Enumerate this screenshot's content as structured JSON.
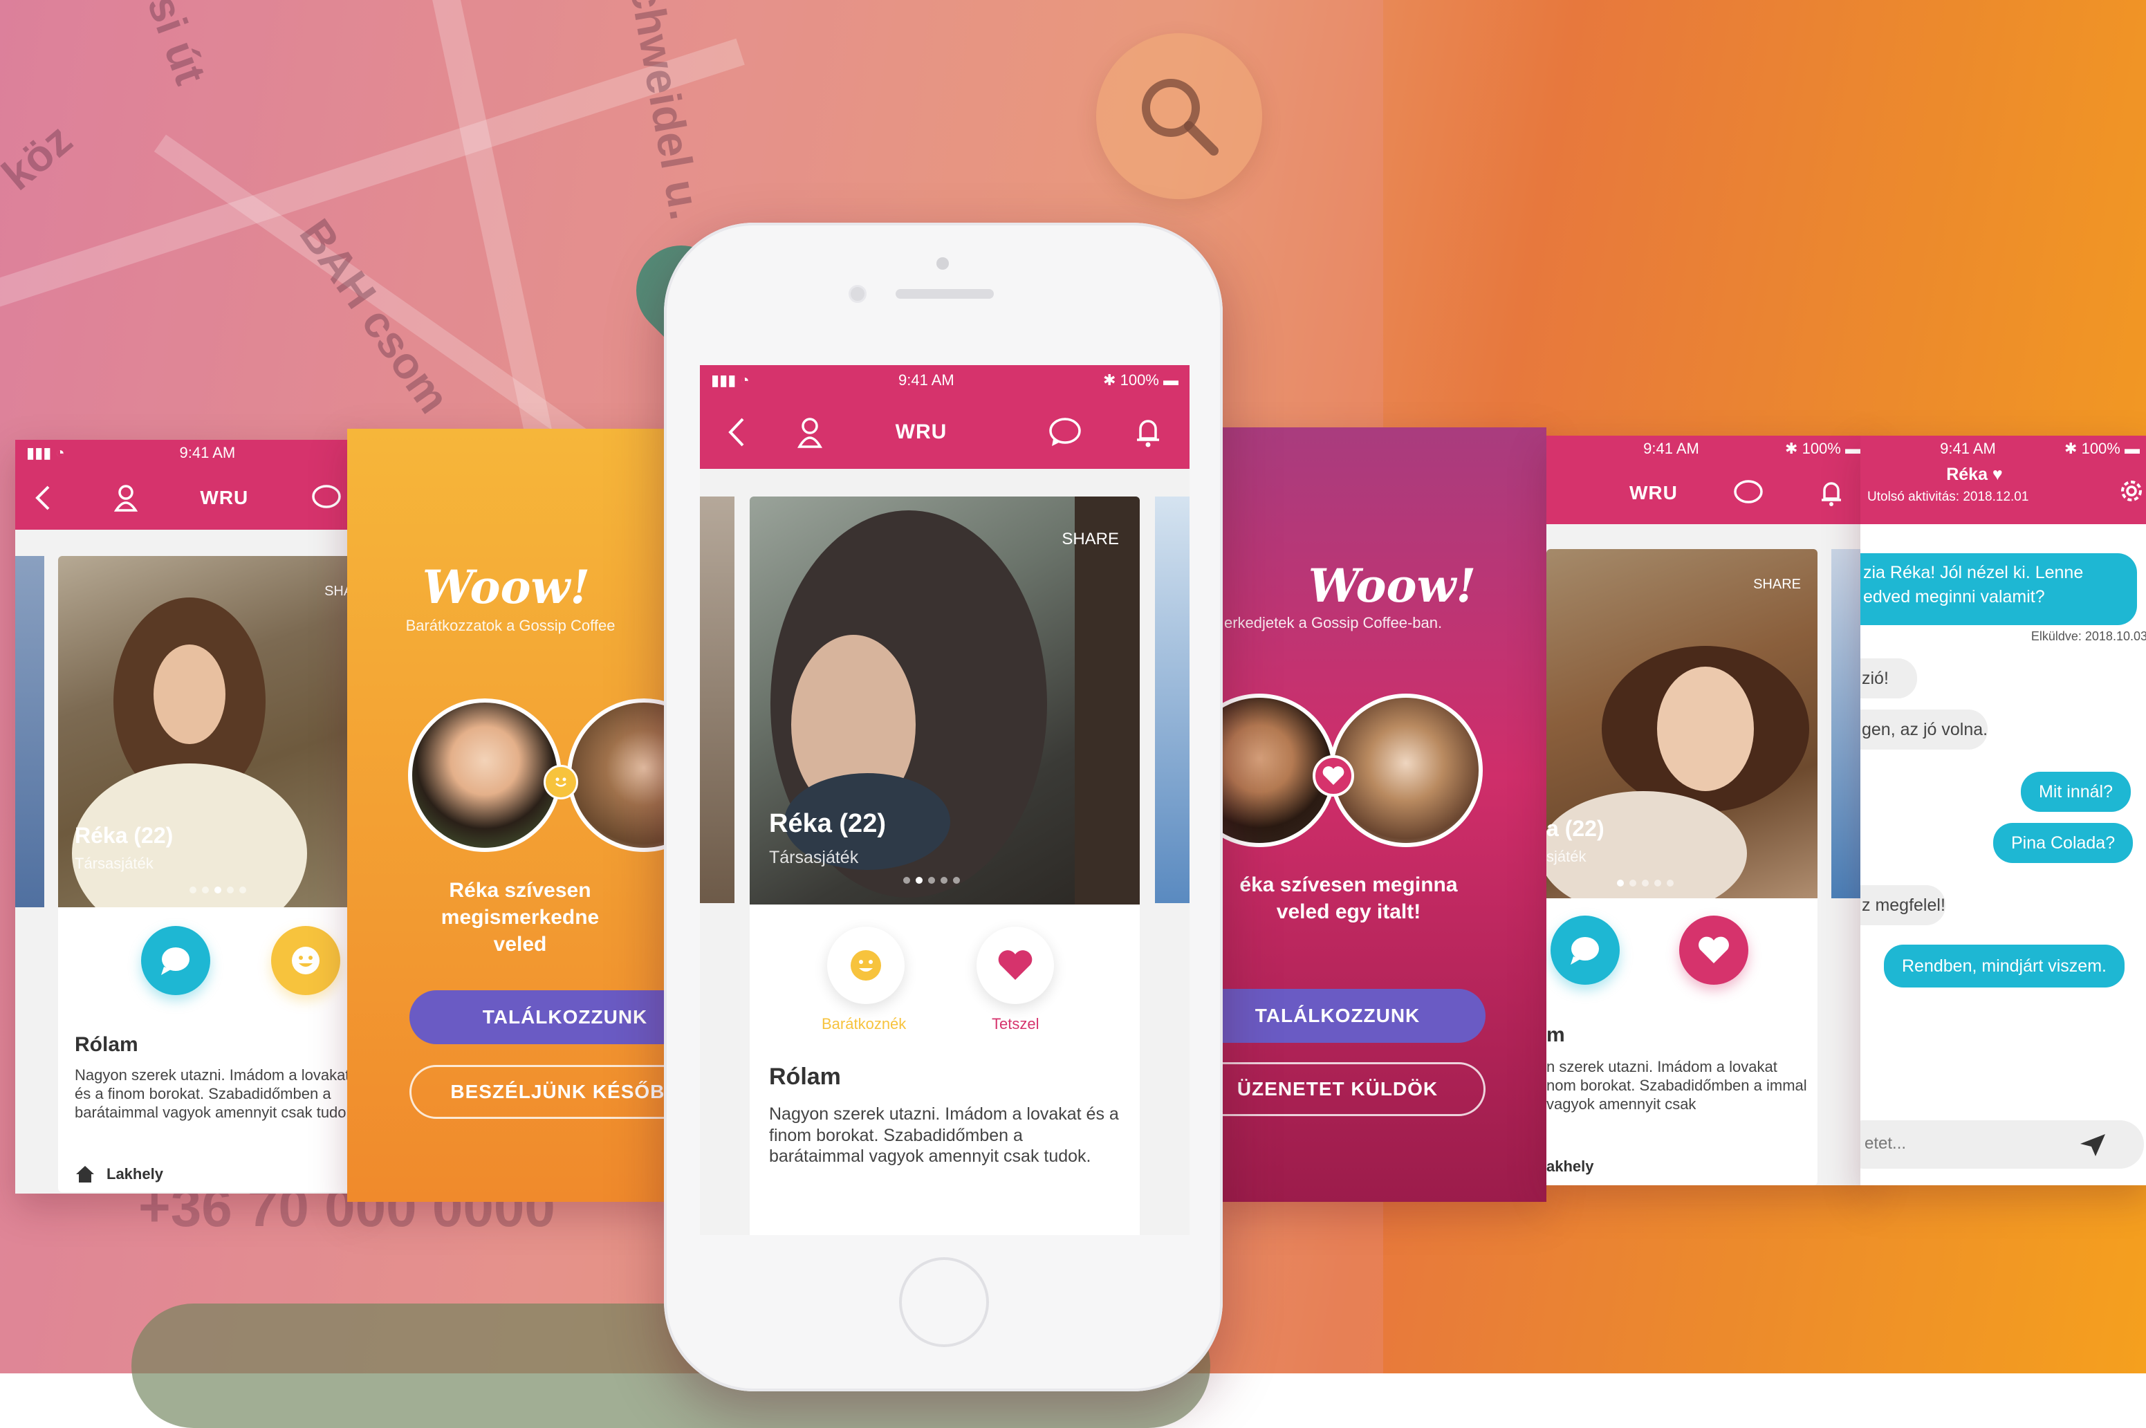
{
  "colors": {
    "brand": "#d6336c",
    "purple_button": "#6a5bc4",
    "teal": "#1eb7d3",
    "yellow": "#f7c33d"
  },
  "background": {
    "streets": [
      "si út",
      "köz",
      "chweidel u.",
      "BAH csom"
    ],
    "phone_text": "+36 70 000 0000"
  },
  "status": {
    "time": "9:41 AM",
    "battery": "100%"
  },
  "nav": {
    "title": "WRU"
  },
  "profile": {
    "name": "Réka (22)",
    "hobby": "Társasjáték",
    "share": "SHARE",
    "about_title": "Rólam",
    "about_text": "Nagyon szerek utazni. Imádom a lovakat és a finom borokat. Szabadidőmben a barátaimmal vagyok amennyit csak tudok.",
    "home_label": "Lakhely",
    "action_friend_label": "Barátkoznék",
    "action_like_label": "Tetszel"
  },
  "match_friend": {
    "woow": "Woow!",
    "subtitle": "Barátkozzatok a Gossip Coffee",
    "message": "Réka szívesen megismerkedne veled",
    "primary_button": "TALÁLKOZZUNK",
    "secondary_button": "BESZÉLJÜNK KÉSŐBB"
  },
  "match_date": {
    "woow": "Woow!",
    "subtitle": "erkedjetek a Gossip Coffee-ban.",
    "message": "éka szívesen meginna veled egy italt!",
    "primary_button": "TALÁLKOZZUNK",
    "secondary_button": "ÜZENETET KÜLDÖK"
  },
  "right_profile": {
    "name": "a (22)",
    "hobby": "sjáték",
    "share": "SHARE",
    "about_title": "m",
    "home_label": "akhely",
    "about_text": "n szerek utazni. Imádom a lovakat nom borokat. Szabadidőmben a immal vagyok amennyit csak"
  },
  "chat": {
    "name": "Réka ♥",
    "last_active": "Utolsó aktivitás: 2018.12.01",
    "messages": [
      {
        "dir": "out",
        "text": "zia Réka! Jól nézel ki. Lenne"
      },
      {
        "dir": "out",
        "text": "edved meginni valamit?"
      },
      {
        "dir": "meta",
        "text": "Elküldve: 2018.10.03."
      },
      {
        "dir": "in",
        "text": "zió!"
      },
      {
        "dir": "in",
        "text": "gen, az jó volna."
      },
      {
        "dir": "out",
        "text": "Mit innál?"
      },
      {
        "dir": "out",
        "text": "Pina Colada?"
      },
      {
        "dir": "in",
        "text": "z megfelel!"
      },
      {
        "dir": "out",
        "text": "Rendben, mindjárt viszem."
      }
    ],
    "input_placeholder": "etet..."
  }
}
